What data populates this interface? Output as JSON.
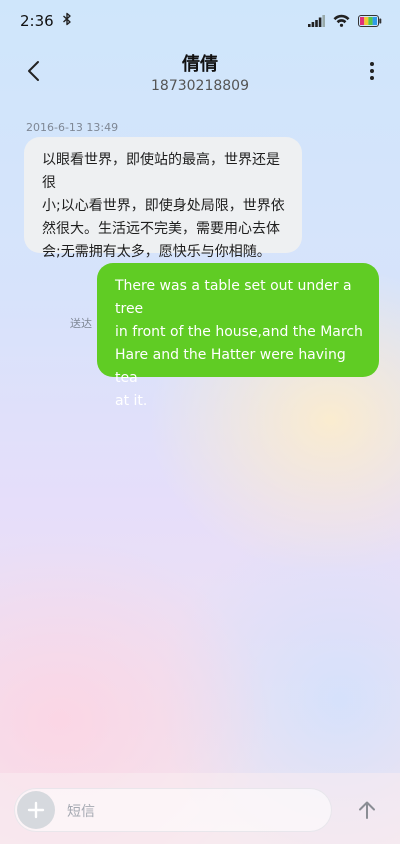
{
  "status_bar": {
    "time": "2:36",
    "icons": [
      "bluetooth-icon",
      "signal-icon",
      "wifi-icon",
      "battery-icon"
    ]
  },
  "header": {
    "contact_name": "倩倩",
    "phone_number": "18730218809",
    "icons": [
      "back-arrow-icon",
      "more-vertical-icon"
    ]
  },
  "messages": [
    {
      "direction": "incoming",
      "timestamp": "2016-6-13 13:49",
      "lines": [
        "以眼看世界，即使站的最高，世界还是很",
        "小;以心看世界，即使身处局限，世界依",
        "然很大。生活远不完美，需要用心去体",
        "会;无需拥有太多，愿快乐与你相随。"
      ]
    },
    {
      "direction": "outgoing",
      "status": "送达",
      "lines": [
        "There was a table set out under a tree",
        "in front of the house,and the March",
        "Hare and the Hatter were having tea",
        "at it."
      ]
    }
  ],
  "composer": {
    "placeholder": "短信",
    "icons": [
      "add-icon",
      "send-arrow-icon"
    ]
  },
  "colors": {
    "outgoing_bubble": "#60cc24",
    "incoming_bubble": "#eef0f2"
  }
}
